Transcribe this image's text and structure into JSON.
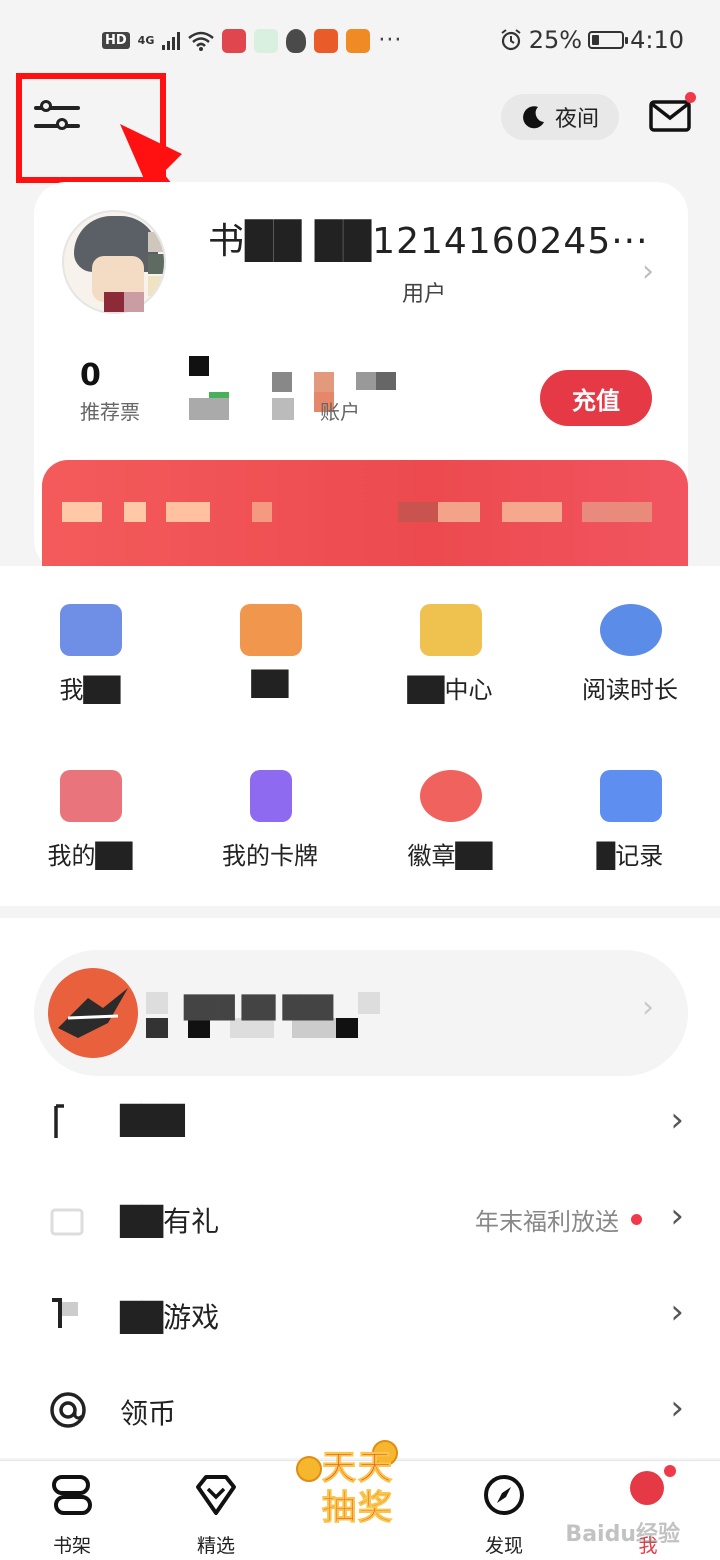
{
  "status_bar": {
    "network": "HD",
    "signal_type": "4G",
    "battery_text": "25%",
    "battery_level": 0.25,
    "time": "4:10",
    "more": "···"
  },
  "top_bar": {
    "night_mode_label": "夜间"
  },
  "profile": {
    "username": "书██  ██1214160245···",
    "user_tag": "用户",
    "stat_value": "0",
    "stat_label": "推荐票",
    "account_label": "账户",
    "recharge_label": "充值"
  },
  "grid": [
    {
      "label": "我██",
      "icon": "blue-square-icon",
      "color": "#6f8fe6"
    },
    {
      "label": "██",
      "icon": "orange-square-icon",
      "color": "#f1974d"
    },
    {
      "label": "██中心",
      "icon": "yellow-square-icon",
      "color": "#efc24f"
    },
    {
      "label": "阅读时长",
      "icon": "clock-icon",
      "color": "#5b8de8"
    },
    {
      "label": "我的██",
      "icon": "pink-square-icon",
      "color": "#e9747c"
    },
    {
      "label": "我的卡牌",
      "icon": "card-icon",
      "color": "#8e6af0"
    },
    {
      "label": "徽章██",
      "icon": "medal-icon",
      "color": "#f0625d"
    },
    {
      "label": "█记录",
      "icon": "shield-icon",
      "color": "#5e8ff0"
    }
  ],
  "list": {
    "banner_text": "███ ██ ███",
    "rows": [
      {
        "label": "███",
        "icon": "book-icon",
        "hint": ""
      },
      {
        "label": "██有礼",
        "icon": "gift-icon",
        "hint": "年末福利放送"
      },
      {
        "label": "██游戏",
        "icon": "game-icon",
        "hint": ""
      },
      {
        "label": "领币",
        "icon": "coin-at-icon",
        "hint": ""
      }
    ]
  },
  "bottom_nav": [
    {
      "label": "书架",
      "icon": "bookshelf-icon"
    },
    {
      "label": "精选",
      "icon": "diamond-icon"
    },
    {
      "label": "发现",
      "icon": "compass-icon"
    },
    {
      "label": "我",
      "icon": "profile-icon"
    }
  ],
  "lottery": {
    "line1": "天天",
    "line2": "抽奖"
  },
  "watermark": "Baidu经验",
  "colors": {
    "accent": "#e53a46",
    "annotation": "#ff1111"
  }
}
